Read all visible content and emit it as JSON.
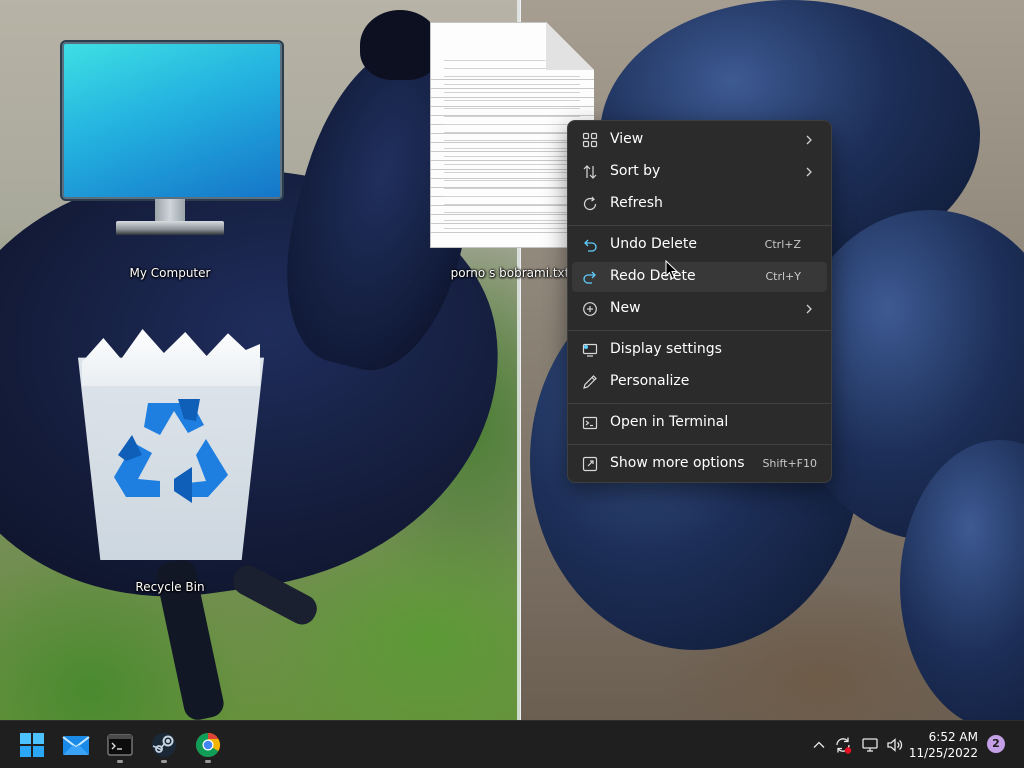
{
  "desktop": {
    "icons": [
      {
        "label": "My Computer"
      },
      {
        "label": "porno s bobrami.txt"
      },
      {
        "label": "Recycle Bin"
      }
    ]
  },
  "context_menu": {
    "items": [
      {
        "label": "View",
        "icon": "grid-icon",
        "submenu": true
      },
      {
        "label": "Sort by",
        "icon": "sort-icon",
        "submenu": true
      },
      {
        "label": "Refresh",
        "icon": "refresh-icon"
      },
      {
        "label": "Undo Delete",
        "icon": "undo-icon",
        "shortcut": "Ctrl+Z"
      },
      {
        "label": "Redo Delete",
        "icon": "redo-icon",
        "shortcut": "Ctrl+Y",
        "highlighted": true
      },
      {
        "label": "New",
        "icon": "plus-circle-icon",
        "submenu": true
      },
      {
        "label": "Display settings",
        "icon": "display-settings-icon"
      },
      {
        "label": "Personalize",
        "icon": "pen-icon"
      },
      {
        "label": "Open in Terminal",
        "icon": "terminal-icon"
      },
      {
        "label": "Show more options",
        "icon": "more-options-icon",
        "shortcut": "Shift+F10"
      }
    ]
  },
  "taskbar": {
    "apps": [
      {
        "name": "start-icon"
      },
      {
        "name": "mail-icon"
      },
      {
        "name": "terminal-app-icon",
        "running": true
      },
      {
        "name": "steam-icon",
        "running": true
      },
      {
        "name": "chrome-icon",
        "running": true
      }
    ],
    "tray": {
      "icons": [
        "chevron-up-icon",
        "sync-icon",
        "network-icon",
        "volume-icon"
      ],
      "time": "6:52 AM",
      "date": "11/25/2022",
      "notification_count": "2"
    }
  },
  "colors": {
    "menu_bg": "#2b2b2b",
    "menu_hover": "#383838",
    "taskbar_bg": "#1f1f1f",
    "accent": "#60cdff",
    "notification_badge": "#c4a0e6"
  }
}
